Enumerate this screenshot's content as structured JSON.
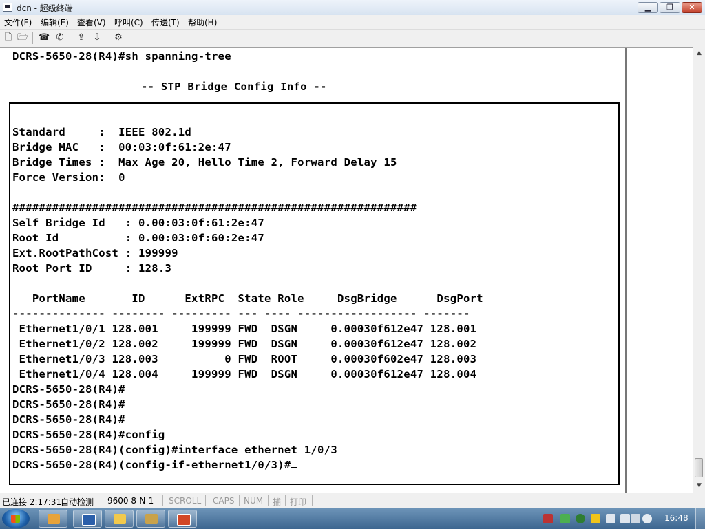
{
  "window": {
    "title": "dcn - 超级终端",
    "minimize": "▁",
    "maximize": "❐",
    "close": "✕"
  },
  "menu": [
    "文件(F)",
    "编辑(E)",
    "查看(V)",
    "呼叫(C)",
    "传送(T)",
    "帮助(H)"
  ],
  "toolbar": {
    "icons": [
      "new-icon",
      "open-icon",
      "connect-icon",
      "disconnect-icon",
      "send-icon",
      "receive-icon",
      "properties-icon"
    ],
    "glyphs": [
      "🗋",
      "🗁",
      "☎",
      "✆",
      "⇪",
      "⇩",
      "⚙"
    ]
  },
  "terminal": {
    "header_cmd": "DCRS-5650-28(R4)#sh spanning-tree",
    "section_title": "-- STP Bridge Config Info --",
    "lines": [
      "Standard     :  IEEE 802.1d",
      "Bridge MAC   :  00:03:0f:61:2e:47",
      "Bridge Times :  Max Age 20, Hello Time 2, Forward Delay 15",
      "Force Version:  0",
      "",
      "#############################################################",
      "Self Bridge Id   : 0.00:03:0f:61:2e:47",
      "Root Id          : 0.00:03:0f:60:2e:47",
      "Ext.RootPathCost : 199999",
      "Root Port ID     : 128.3",
      "",
      "   PortName       ID      ExtRPC  State Role     DsgBridge      DsgPort",
      "-------------- -------- --------- --- ---- ------------------ -------",
      " Ethernet1/0/1 128.001     199999 FWD  DSGN     0.00030f612e47 128.001",
      " Ethernet1/0/2 128.002     199999 FWD  DSGN     0.00030f612e47 128.002",
      " Ethernet1/0/3 128.003          0 FWD  ROOT     0.00030f602e47 128.003",
      " Ethernet1/0/4 128.004     199999 FWD  DSGN     0.00030f612e47 128.004",
      "DCRS-5650-28(R4)#",
      "DCRS-5650-28(R4)#",
      "DCRS-5650-28(R4)#",
      "DCRS-5650-28(R4)#config",
      "DCRS-5650-28(R4)(config)#interface ethernet 1/0/3",
      "DCRS-5650-28(R4)(config-if-ethernet1/0/3)#"
    ]
  },
  "statusbar": {
    "connected": "已连接 2:17:31",
    "detect": "自动检测",
    "params": "9600 8-N-1",
    "scroll": "SCROLL",
    "caps": "CAPS",
    "num": "NUM",
    "capture": "捕",
    "print": "打印"
  },
  "taskbar": {
    "clock": "16:48",
    "apps": [
      "word-icon",
      "explorer-folder-icon",
      "files-icon",
      "powerpoint-icon"
    ]
  }
}
